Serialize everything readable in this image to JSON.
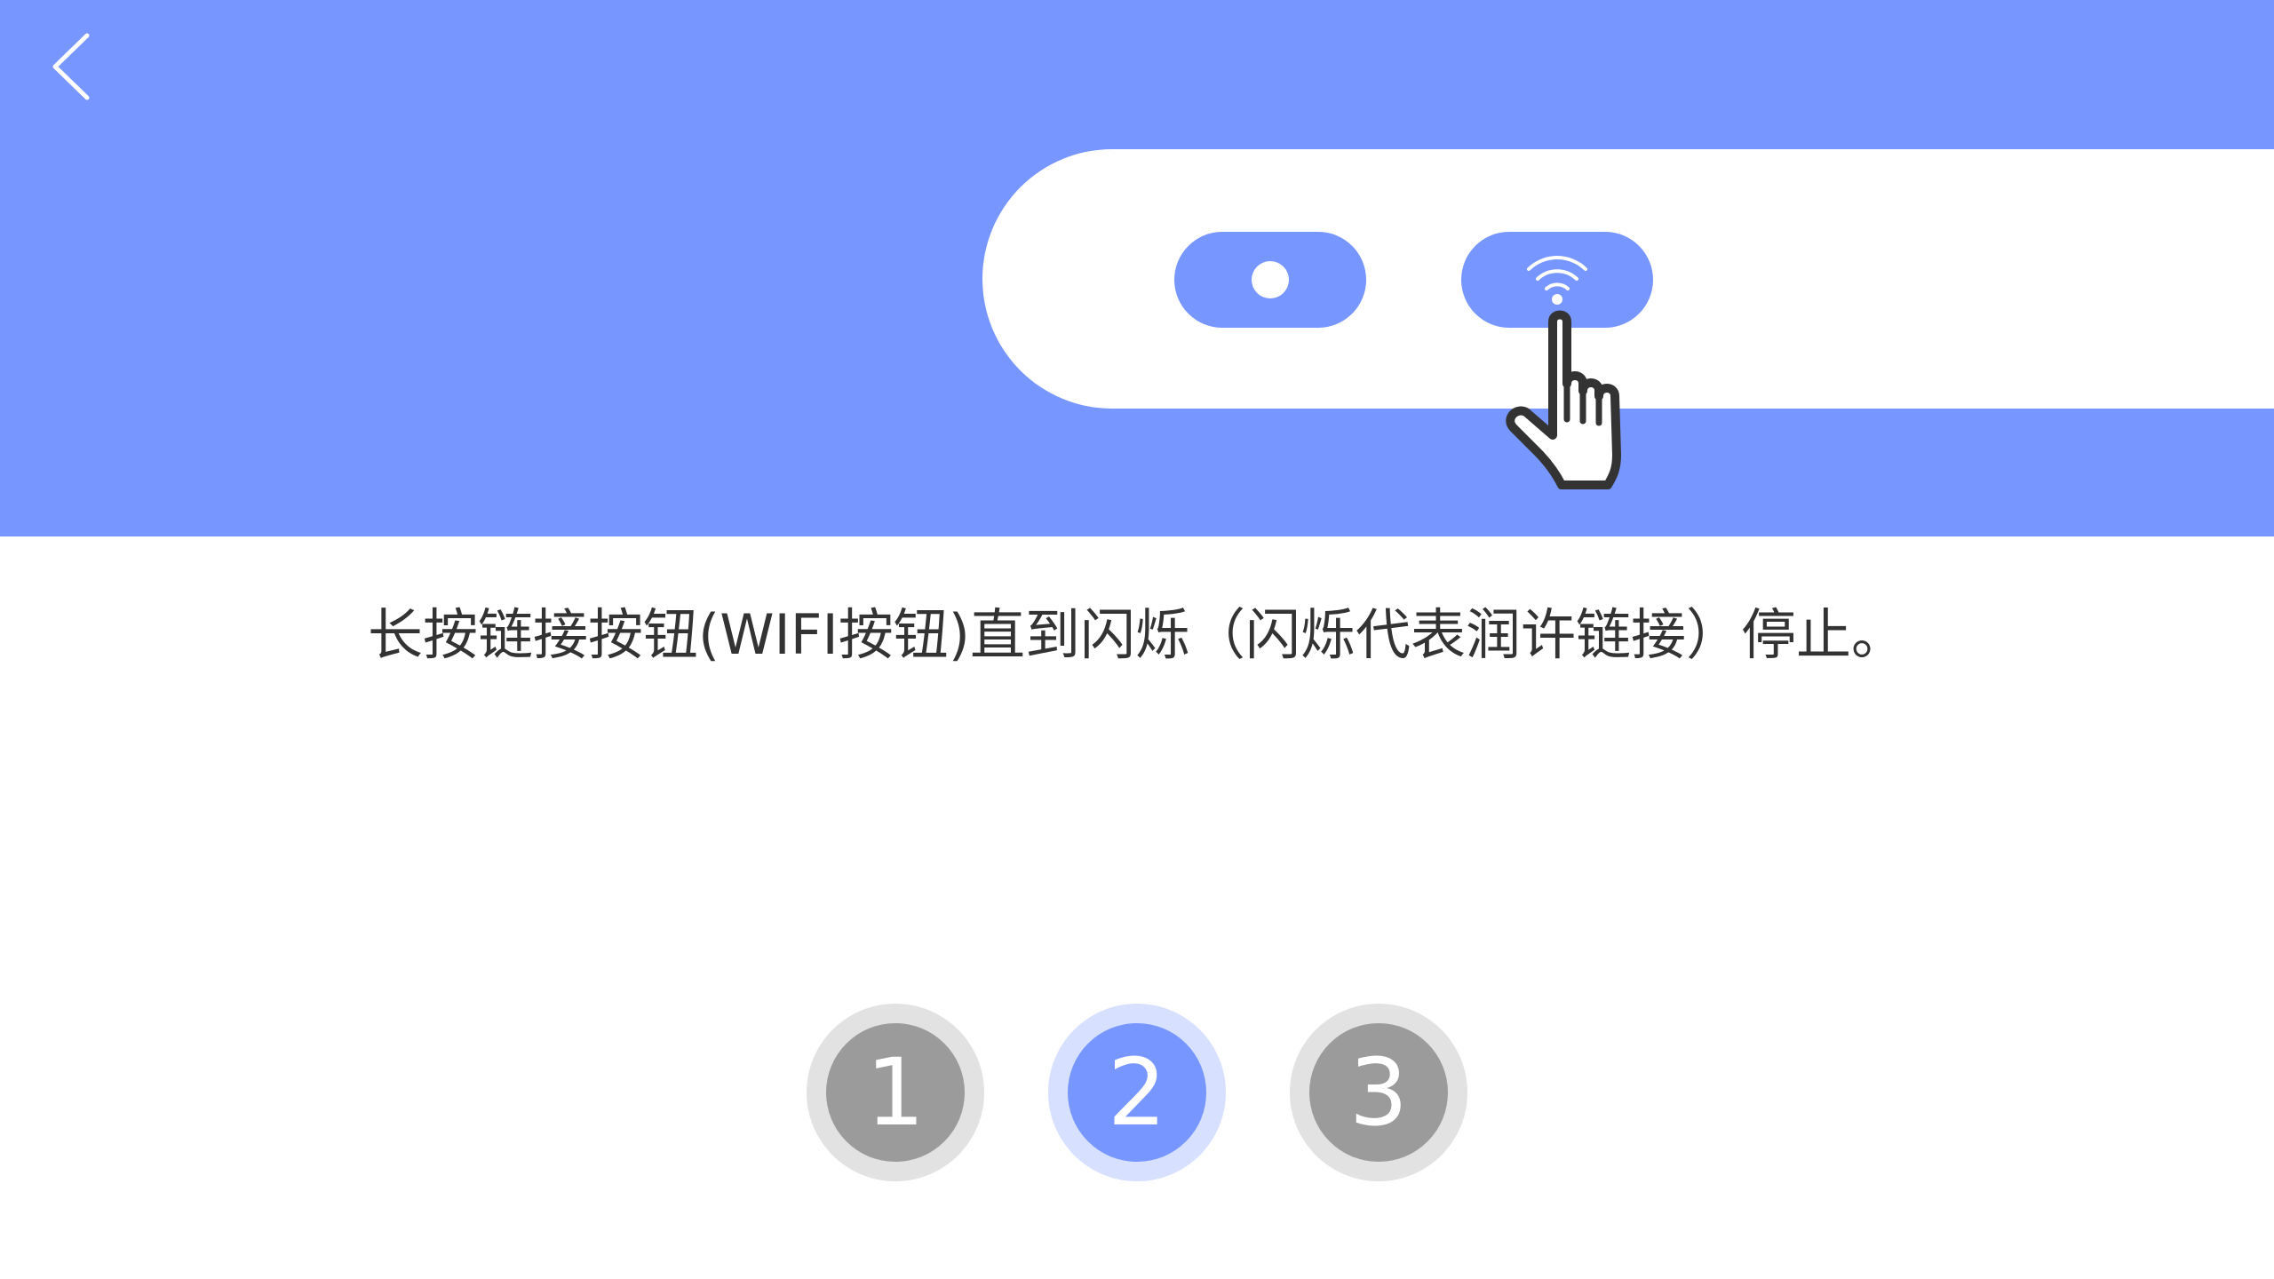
{
  "colors": {
    "accent": "#7896FF",
    "accent_light": "#D7E0FF",
    "inactive_outer": "#E2E2E2",
    "inactive_inner": "#9B9B9B",
    "white": "#FFFFFF",
    "text": "#333333",
    "hand_outline": "#333333"
  },
  "header": {
    "back_icon": "chevron-left-icon"
  },
  "illustration": {
    "power_indicator_icon": "dot-icon",
    "wifi_button_icon": "wifi-icon",
    "pointer_icon": "hand-pointer-icon"
  },
  "instruction": {
    "text": "长按链接按钮(WIFI按钮)直到闪烁（闪烁代表润许链接）停止。"
  },
  "steps": [
    {
      "label": "1",
      "state": "inactive"
    },
    {
      "label": "2",
      "state": "active"
    },
    {
      "label": "3",
      "state": "inactive"
    }
  ]
}
